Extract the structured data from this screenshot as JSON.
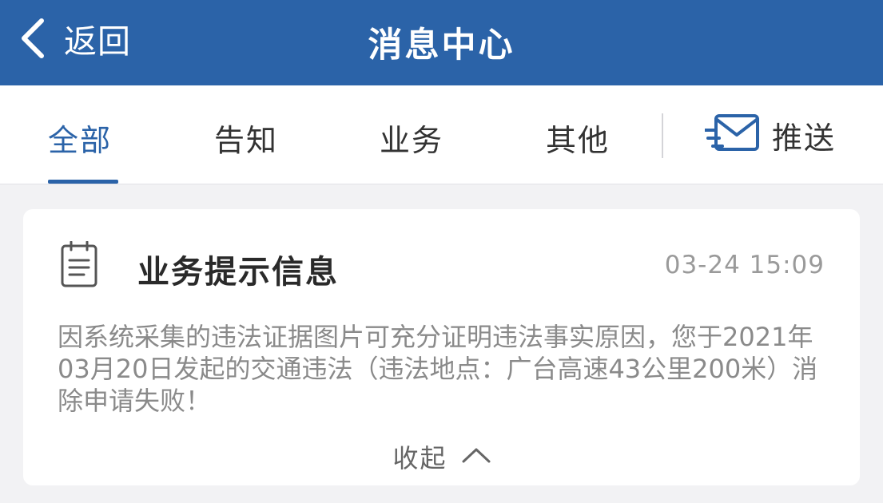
{
  "header": {
    "back_label": "返回",
    "title": "消息中心"
  },
  "tabs": [
    {
      "label": "全部",
      "active": true
    },
    {
      "label": "告知",
      "active": false
    },
    {
      "label": "业务",
      "active": false
    },
    {
      "label": "其他",
      "active": false
    }
  ],
  "push": {
    "label": "推送",
    "icon": "mail-send-icon"
  },
  "message": {
    "icon": "notepad-icon",
    "title": "业务提示信息",
    "time": "03-24 15:09",
    "body": "因系统采集的违法证据图片可充分证明违法事实原因，您于2021年03月20日发起的交通违法（违法地点：广台高速43公里200米）消除申请失败！",
    "collapse_label": "收起"
  },
  "colors": {
    "header_bg": "#2b63a8",
    "accent": "#2b63a8",
    "page_bg": "#f2f2f4"
  }
}
